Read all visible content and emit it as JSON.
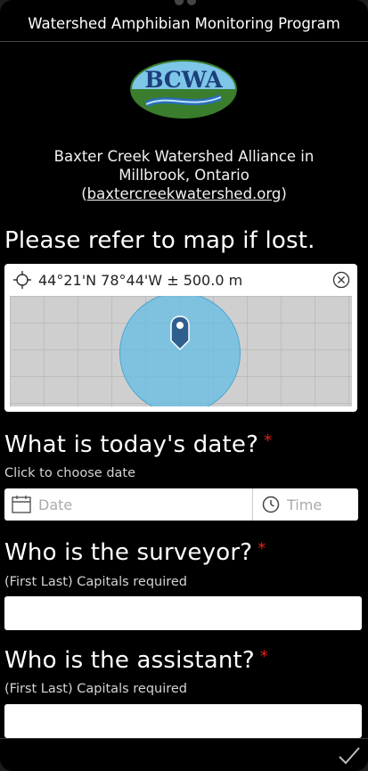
{
  "header": {
    "title": "Watershed Amphibian Monitoring Program"
  },
  "logo": {
    "text": "BCWA"
  },
  "org": {
    "line1": "Baxter Creek Watershed Alliance in",
    "line2": "Millbrook, Ontario",
    "link": "baxtercreekwatershed.org"
  },
  "map_section": {
    "question": "Please refer to map if lost.",
    "coords": "44°21'N 78°44'W ± 500.0 m"
  },
  "date_section": {
    "question": "What is today's date?",
    "required_mark": "*",
    "hint": "Click to choose date",
    "date_placeholder": "Date",
    "time_placeholder": "Time"
  },
  "surveyor_section": {
    "question": "Who is the surveyor?",
    "required_mark": "*",
    "hint": "(First Last) Capitals required",
    "value": ""
  },
  "assistant_section": {
    "question": "Who is the assistant?",
    "required_mark": "*",
    "hint": "(First Last) Capitals required",
    "value": ""
  },
  "colors": {
    "required": "#e0241b",
    "accent_circle": "#64bee6",
    "pin": "#2f5f8f"
  },
  "icons": [
    "crosshair-icon",
    "clear-icon",
    "location-pin-icon",
    "calendar-icon",
    "clock-icon",
    "checkmark-icon"
  ]
}
